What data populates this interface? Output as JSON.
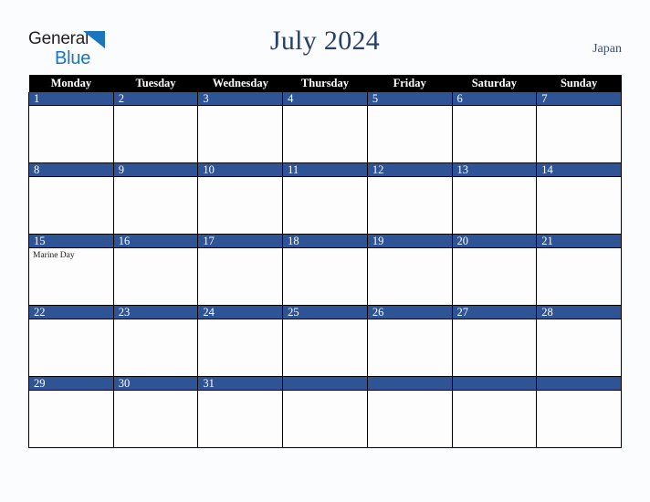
{
  "brand": {
    "name_part1": "General",
    "name_part2": "Blue",
    "triangle_icon": "triangle-icon",
    "accent_color": "#1b75bc",
    "text_color": "#231f20"
  },
  "header": {
    "title": "July 2024",
    "region": "Japan",
    "title_color": "#27406b"
  },
  "calendar": {
    "month": "July",
    "year": "2024",
    "week_start": "Monday",
    "header_bg": "#000000",
    "daynum_bg": "#2f5496",
    "cell_bg": "#fdfdfd",
    "weekdays": [
      "Monday",
      "Tuesday",
      "Wednesday",
      "Thursday",
      "Friday",
      "Saturday",
      "Sunday"
    ],
    "weeks": [
      [
        {
          "day": "1",
          "event": ""
        },
        {
          "day": "2",
          "event": ""
        },
        {
          "day": "3",
          "event": ""
        },
        {
          "day": "4",
          "event": ""
        },
        {
          "day": "5",
          "event": ""
        },
        {
          "day": "6",
          "event": ""
        },
        {
          "day": "7",
          "event": ""
        }
      ],
      [
        {
          "day": "8",
          "event": ""
        },
        {
          "day": "9",
          "event": ""
        },
        {
          "day": "10",
          "event": ""
        },
        {
          "day": "11",
          "event": ""
        },
        {
          "day": "12",
          "event": ""
        },
        {
          "day": "13",
          "event": ""
        },
        {
          "day": "14",
          "event": ""
        }
      ],
      [
        {
          "day": "15",
          "event": "Marine Day"
        },
        {
          "day": "16",
          "event": ""
        },
        {
          "day": "17",
          "event": ""
        },
        {
          "day": "18",
          "event": ""
        },
        {
          "day": "19",
          "event": ""
        },
        {
          "day": "20",
          "event": ""
        },
        {
          "day": "21",
          "event": ""
        }
      ],
      [
        {
          "day": "22",
          "event": ""
        },
        {
          "day": "23",
          "event": ""
        },
        {
          "day": "24",
          "event": ""
        },
        {
          "day": "25",
          "event": ""
        },
        {
          "day": "26",
          "event": ""
        },
        {
          "day": "27",
          "event": ""
        },
        {
          "day": "28",
          "event": ""
        }
      ],
      [
        {
          "day": "29",
          "event": ""
        },
        {
          "day": "30",
          "event": ""
        },
        {
          "day": "31",
          "event": ""
        },
        {
          "day": "",
          "event": ""
        },
        {
          "day": "",
          "event": ""
        },
        {
          "day": "",
          "event": ""
        },
        {
          "day": "",
          "event": ""
        }
      ]
    ]
  }
}
